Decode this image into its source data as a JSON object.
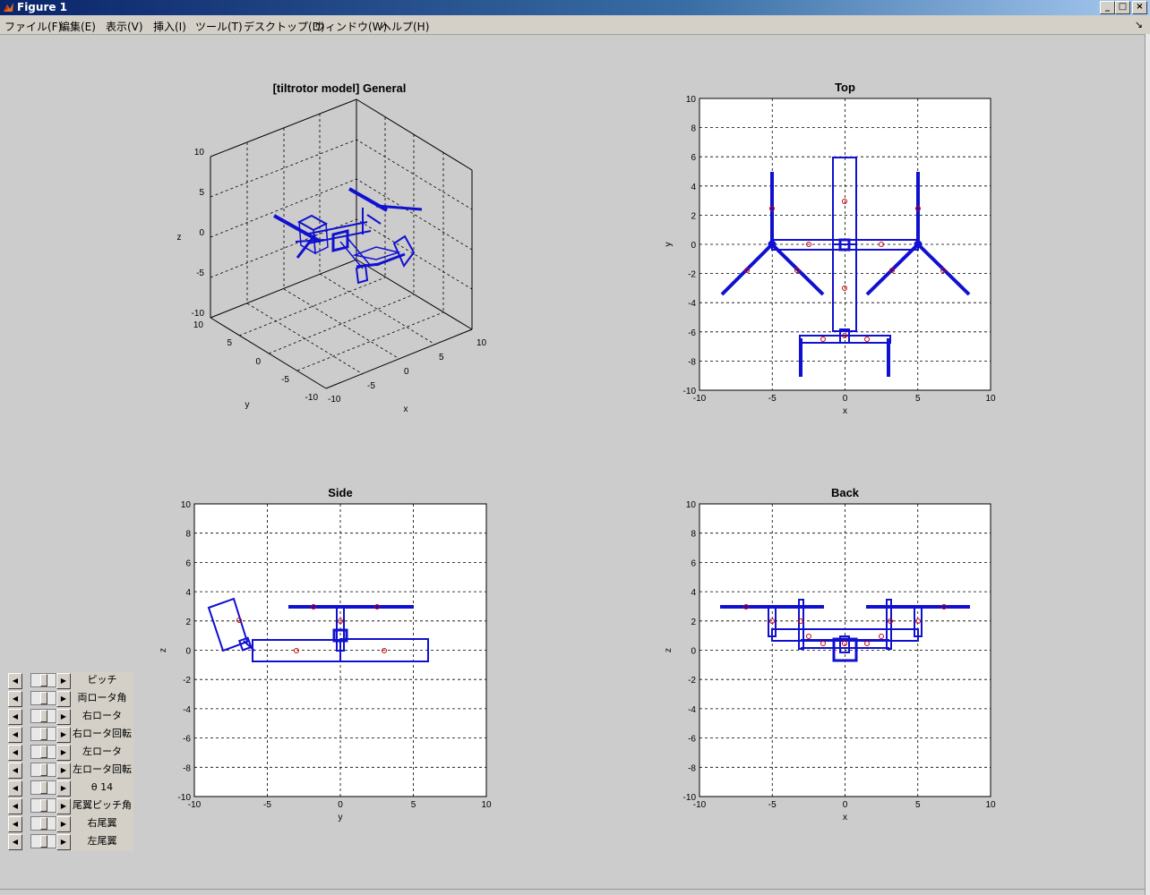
{
  "window": {
    "title": "Figure 1",
    "buttons": [
      "_",
      "□",
      "×"
    ]
  },
  "menu": {
    "items": [
      "ファイル(F)",
      "編集(E)",
      "表示(V)",
      "挿入(I)",
      "ツール(T)",
      "デスクトップ(D)",
      "ウィンドウ(W)",
      "ヘルプ(H)"
    ],
    "dock_icon": "dock-arrow-icon"
  },
  "plots": {
    "general": {
      "title": "[tiltrotor model] General",
      "xlabel": "x",
      "ylabel": "y",
      "zlabel": "z",
      "z_ticks": [
        "10",
        "5",
        "0",
        "-5",
        "-10"
      ],
      "y_ticks": [
        "10",
        "5",
        "0",
        "-5",
        "-10"
      ],
      "x_ticks": [
        "-10",
        "-5",
        "0",
        "5",
        "10"
      ]
    },
    "top": {
      "title": "Top",
      "xlabel": "x",
      "ylabel": "y",
      "x_ticks": [
        "-10",
        "-5",
        "0",
        "5",
        "10"
      ],
      "y_ticks": [
        "10",
        "8",
        "6",
        "4",
        "2",
        "0",
        "-2",
        "-4",
        "-6",
        "-8",
        "-10"
      ]
    },
    "side": {
      "title": "Side",
      "xlabel": "y",
      "ylabel": "z",
      "x_ticks": [
        "-10",
        "-5",
        "0",
        "5",
        "10"
      ],
      "y_ticks": [
        "10",
        "8",
        "6",
        "4",
        "2",
        "0",
        "-2",
        "-4",
        "-6",
        "-8",
        "-10"
      ]
    },
    "back": {
      "title": "Back",
      "xlabel": "x",
      "ylabel": "z",
      "x_ticks": [
        "-10",
        "-5",
        "0",
        "5",
        "10"
      ],
      "y_ticks": [
        "10",
        "8",
        "6",
        "4",
        "2",
        "0",
        "-2",
        "-4",
        "-6",
        "-8",
        "-10"
      ]
    }
  },
  "sliders": {
    "labels": [
      "ピッチ",
      "両ロータ角",
      "右ロータ",
      "右ロータ回転",
      "左ロータ",
      "左ロータ回転",
      "θ 14",
      "尾翼ピッチ角",
      "右尾翼",
      "左尾翼"
    ],
    "left_arrow": "◀",
    "right_arrow": "▶"
  },
  "colors": {
    "model_line": "#1010d0",
    "marker": "#cc0000",
    "grid": "#000000",
    "figure_bg": "#cccccc",
    "chrome": "#d4d0c8"
  }
}
